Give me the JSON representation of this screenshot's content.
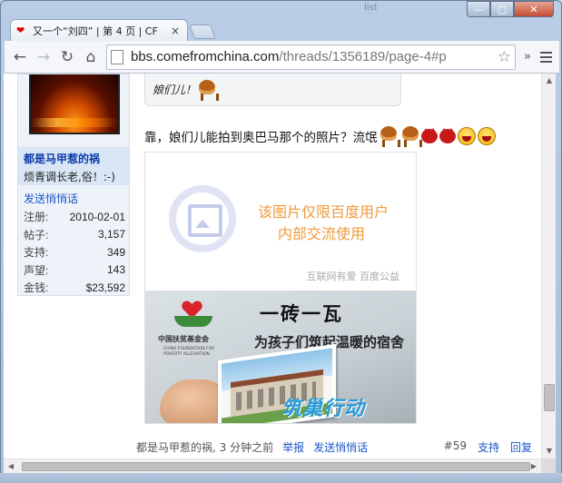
{
  "browser": {
    "tab_title": "又一个“刘四” | 第 4 页 | CF",
    "tab_close": "×",
    "url_host": "bbs.comefromchina.com",
    "url_path": "/threads/1356189/page-4#p",
    "window_bg_text": "list"
  },
  "profile": {
    "username": "都是马甲惹的祸",
    "user_title": "烦青调长老,俗！:-)",
    "send_pm": "发送悄悄话",
    "stats": [
      {
        "label": "注册:",
        "value": "2010-02-01"
      },
      {
        "label": "帖子:",
        "value": "3,157"
      },
      {
        "label": "支持:",
        "value": "349"
      },
      {
        "label": "声望:",
        "value": "143"
      },
      {
        "label": "金钱:",
        "value": "$23,592"
      }
    ]
  },
  "quote": {
    "text": "娘们儿！"
  },
  "post": {
    "text": "靠，娘们儿能拍到奥巴马那个的照片？流氓"
  },
  "image": {
    "placeholder_line1": "该图片仅限百度用户",
    "placeholder_line2": "内部交流使用",
    "placeholder_footer": "互联网有爱  百度公益",
    "ad_org_cn": "中国扶贫基金会",
    "ad_org_en": "CHINA FOUNDATION FOR POVERTY ALLEVIATION",
    "ad_headline": "一砖一瓦",
    "ad_sub": "为孩子们筑起温暖的宿舍",
    "ad_cta": "筑巢行动"
  },
  "footer": {
    "meta": "都是马甲惹的祸, 3 分钟之前",
    "report": "举报",
    "send_pm": "发送悄悄话",
    "post_number": "#59",
    "support": "支持",
    "reply": "回复"
  }
}
